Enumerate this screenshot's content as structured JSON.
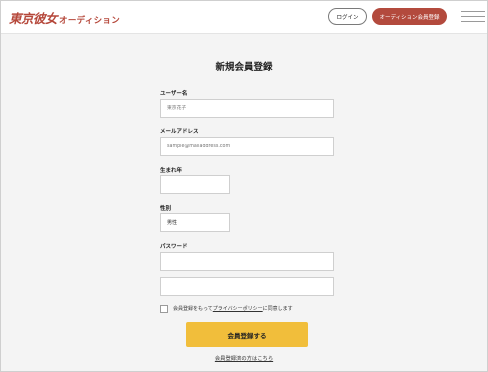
{
  "header": {
    "logo_main": "東京彼女",
    "logo_sub": "オーディション",
    "login_label": "ログイン",
    "register_label": "オーディション会員登録"
  },
  "form": {
    "title": "新規会員登録",
    "username": {
      "label": "ユーザー名",
      "placeholder": "東京花子"
    },
    "email": {
      "label": "メールアドレス",
      "placeholder": "sample@mailaddress.com"
    },
    "birth": {
      "label": "生まれ年",
      "value": ""
    },
    "gender": {
      "label": "性別",
      "value": "男性"
    },
    "password": {
      "label": "パスワード",
      "value": "",
      "confirm_value": ""
    },
    "agree": {
      "prefix": "会員登録をもって",
      "policy": "プライバシーポリシー",
      "suffix": "に同意します",
      "checked": false
    },
    "submit_label": "会員登録する",
    "login_link": "会員登録済の方はこちら"
  }
}
